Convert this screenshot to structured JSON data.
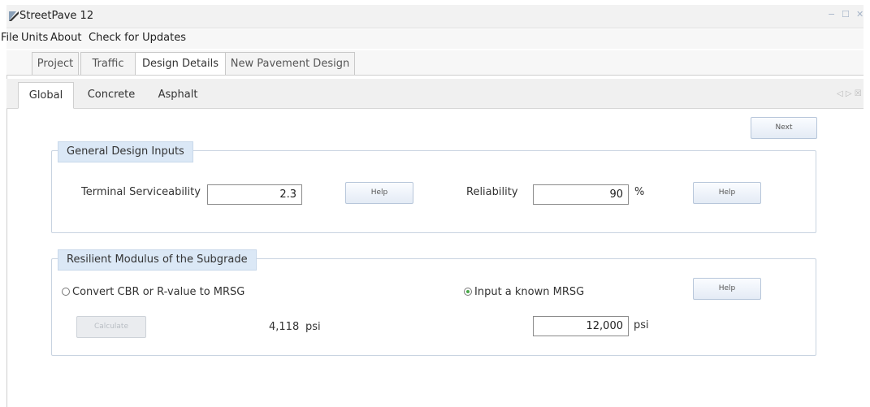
{
  "app": {
    "title": "StreetPave 12",
    "window_controls": {
      "minimize": "−",
      "restore": "☐",
      "close": "✕"
    }
  },
  "menu": [
    "File",
    "Units",
    "About",
    "Check for Updates"
  ],
  "top_tabs": [
    "Project",
    "Traffic",
    "Design Details",
    "New Pavement Design"
  ],
  "top_tab_active": "Design Details",
  "inner_tabs": [
    "Global",
    "Concrete",
    "Asphalt"
  ],
  "inner_tab_active": "Global",
  "inner_tab_controls": "◁ ▷ ☒",
  "next_button": "Next",
  "general": {
    "title": "General Design Inputs",
    "terminal_label": "Terminal Serviceability",
    "terminal_value": "2.3",
    "help_label": "Help",
    "reliability_label": "Reliability",
    "reliability_value": "90",
    "reliability_unit": "%"
  },
  "subgrade": {
    "title": "Resilient Modulus of the Subgrade",
    "option_convert": "Convert CBR or R-value to MRSG",
    "option_input": "Input a known MRSG",
    "selected_option": "input",
    "help_label": "Help",
    "calculate_label": "Calculate",
    "computed_value": "4,118",
    "computed_unit": "psi",
    "known_value": "12,000",
    "known_unit": "psi"
  },
  "colors": {
    "group_title_bg": "#dbe8f6",
    "group_border": "#c8d3e0",
    "button_border": "#b7c6da",
    "radio_selected": "#4aa84a"
  },
  "icons": [
    "app-logo-icon",
    "minimize-icon",
    "restore-icon",
    "close-icon",
    "radio-icon"
  ]
}
